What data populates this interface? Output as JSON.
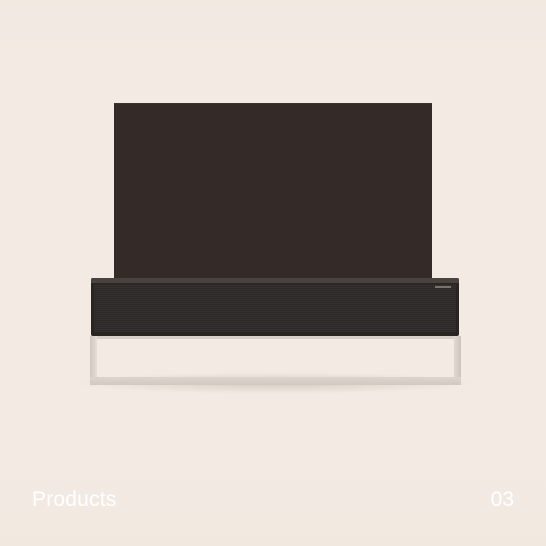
{
  "caption": {
    "title": "Products",
    "page_number": "03"
  },
  "product_image": {
    "subject": "rollable-tv",
    "colors": {
      "screen": "#342b28",
      "cabinet": "#2a2523",
      "stand": "#ddd5cd",
      "background": "#f3ebe3"
    }
  }
}
